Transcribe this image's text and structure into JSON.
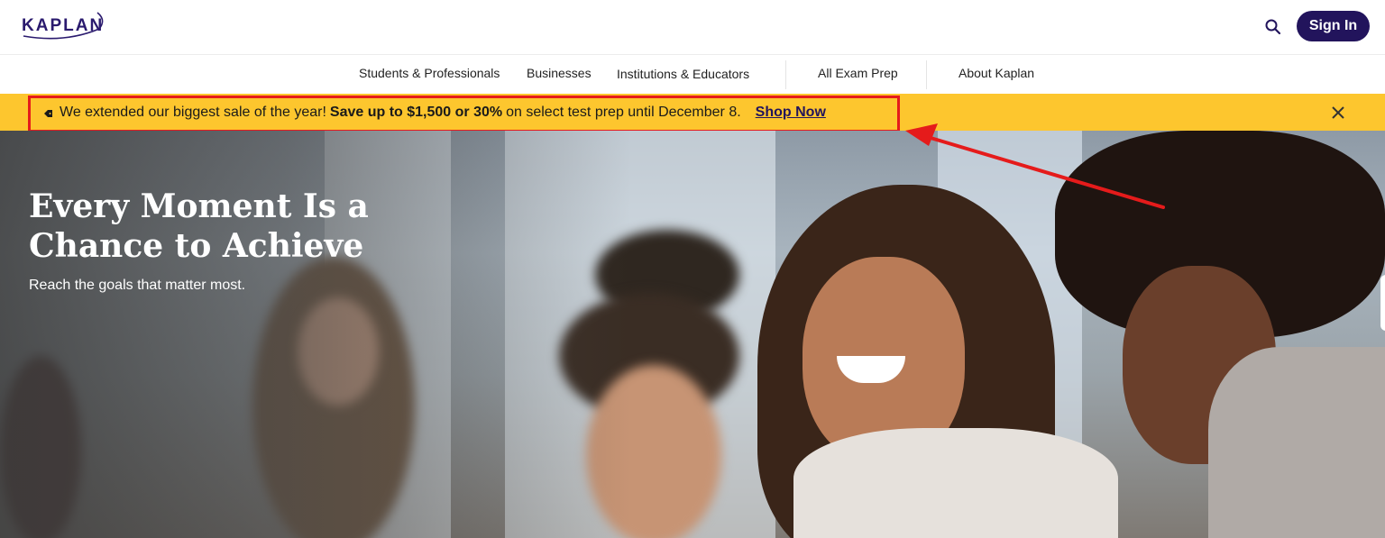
{
  "header": {
    "logo_text": "KAPLAN",
    "signin_label": "Sign In"
  },
  "nav": {
    "items": [
      {
        "label": "Students & Professionals"
      },
      {
        "label": "Businesses"
      },
      {
        "label": "Institutions & Educators"
      },
      {
        "label": "All Exam Prep"
      },
      {
        "label": "About Kaplan"
      }
    ]
  },
  "banner": {
    "text_before": "We extended our biggest sale of the year!",
    "text_bold": "Save up to $1,500 or 30%",
    "text_after": "on select test prep until December 8.",
    "link_label": "Shop Now",
    "icon": "tag-icon"
  },
  "hero": {
    "title": "Every Moment Is a Chance to Achieve",
    "subtitle": "Reach the goals that matter most."
  },
  "colors": {
    "brand": "#22145c",
    "banner": "#fdc62e",
    "annotation": "#e51b1b"
  }
}
